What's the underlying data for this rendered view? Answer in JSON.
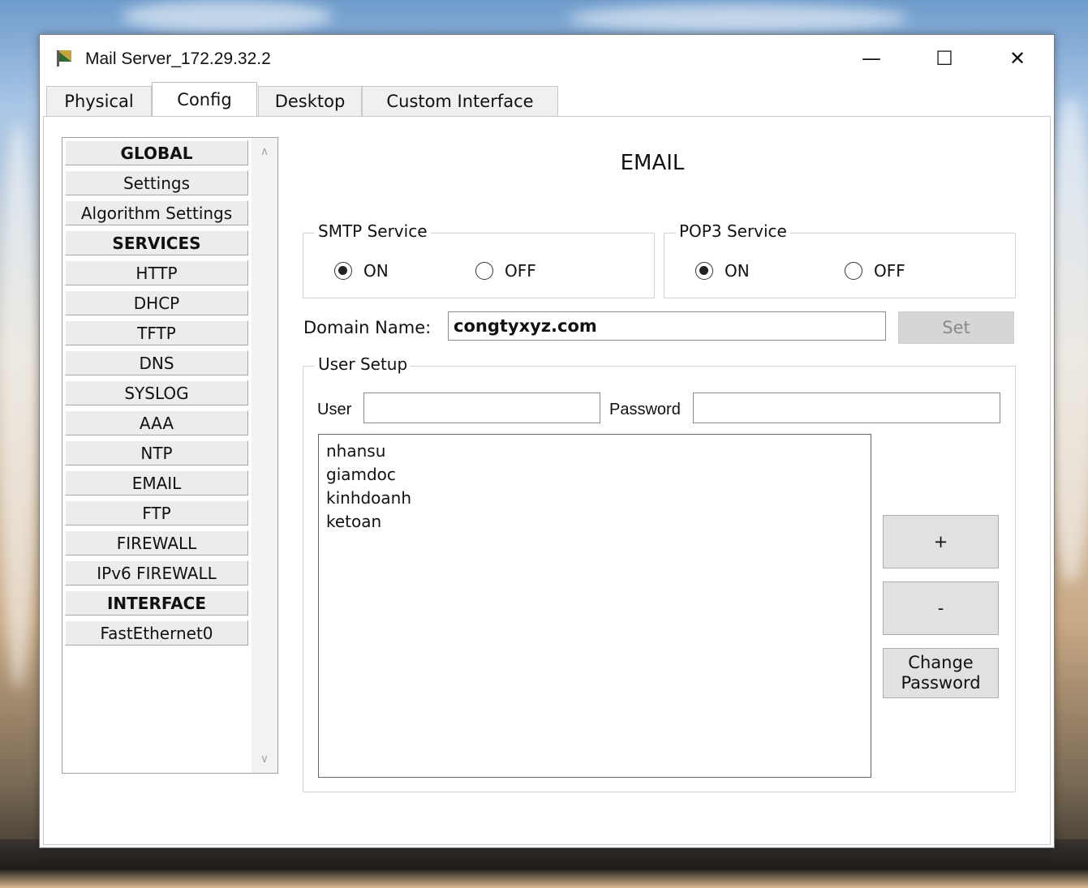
{
  "window": {
    "title": "Mail Server_172.29.32.2",
    "controls": {
      "minimize": "—",
      "maximize": "☐",
      "close": "✕"
    }
  },
  "tabs": [
    {
      "label": "Physical",
      "active": false
    },
    {
      "label": "Config",
      "active": true
    },
    {
      "label": "Desktop",
      "active": false
    },
    {
      "label": "Custom Interface",
      "active": false
    }
  ],
  "sidebar": {
    "items": [
      {
        "label": "GLOBAL",
        "type": "header"
      },
      {
        "label": "Settings",
        "type": "item"
      },
      {
        "label": "Algorithm Settings",
        "type": "item"
      },
      {
        "label": "SERVICES",
        "type": "header"
      },
      {
        "label": "HTTP",
        "type": "item"
      },
      {
        "label": "DHCP",
        "type": "item"
      },
      {
        "label": "TFTP",
        "type": "item"
      },
      {
        "label": "DNS",
        "type": "item"
      },
      {
        "label": "SYSLOG",
        "type": "item"
      },
      {
        "label": "AAA",
        "type": "item"
      },
      {
        "label": "NTP",
        "type": "item"
      },
      {
        "label": "EMAIL",
        "type": "item"
      },
      {
        "label": "FTP",
        "type": "item"
      },
      {
        "label": "FIREWALL",
        "type": "item"
      },
      {
        "label": "IPv6 FIREWALL",
        "type": "item"
      },
      {
        "label": "INTERFACE",
        "type": "header"
      },
      {
        "label": "FastEthernet0",
        "type": "item"
      }
    ],
    "scroll_up": "∧",
    "scroll_down": "∨"
  },
  "email": {
    "title": "EMAIL",
    "smtp": {
      "legend": "SMTP Service",
      "on_label": "ON",
      "off_label": "OFF",
      "selected": "ON"
    },
    "pop3": {
      "legend": "POP3 Service",
      "on_label": "ON",
      "off_label": "OFF",
      "selected": "ON"
    },
    "domain_label": "Domain Name:",
    "domain_value": "congtyxyz.com",
    "set_label": "Set",
    "user_setup": {
      "legend": "User Setup",
      "user_label": "User",
      "user_value": "",
      "password_label": "Password",
      "password_value": "",
      "users": [
        "nhansu",
        "giamdoc",
        "kinhdoanh",
        "ketoan"
      ],
      "add_label": "+",
      "remove_label": "-",
      "change_password_label": "Change\nPassword"
    }
  },
  "colors": {
    "accent_disabled": "#d6d6d6",
    "button_face": "#e1e1e1",
    "sidebar_face": "#ececec"
  }
}
